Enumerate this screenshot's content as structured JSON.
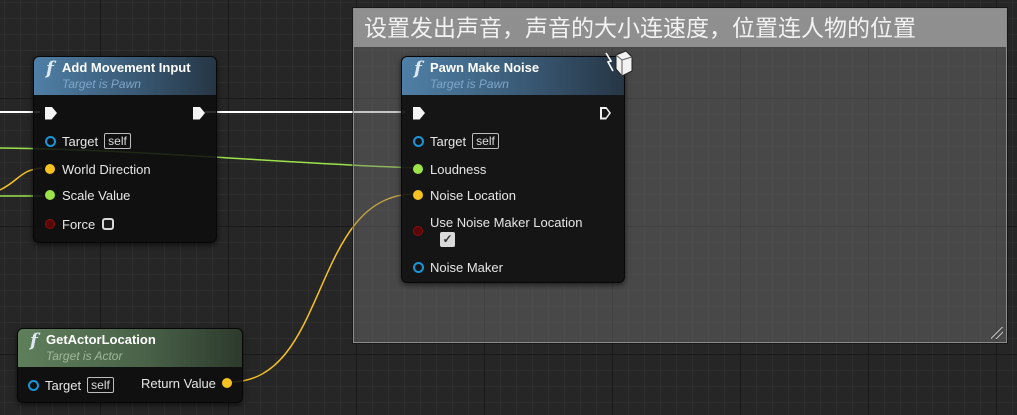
{
  "comment": {
    "title": "设置发出声音，声音的大小连速度，位置连人物的位置"
  },
  "nodes": {
    "add_movement_input": {
      "title": "Add Movement Input",
      "subtitle": "Target is Pawn",
      "pins": {
        "target": "Target",
        "target_default": "self",
        "world_direction": "World Direction",
        "scale_value": "Scale Value",
        "force": "Force"
      }
    },
    "pawn_make_noise": {
      "title": "Pawn Make Noise",
      "subtitle": "Target is Pawn",
      "pins": {
        "target": "Target",
        "target_default": "self",
        "loudness": "Loudness",
        "noise_location": "Noise Location",
        "use_noise_maker_location": "Use Noise Maker Location",
        "noise_maker": "Noise Maker"
      }
    },
    "get_actor_location": {
      "title": "GetActorLocation",
      "subtitle": "Target is Actor",
      "pins": {
        "target": "Target",
        "target_default": "self",
        "return_value": "Return Value"
      }
    }
  },
  "icons": {
    "function": "f",
    "checkmark": "✓"
  },
  "colors": {
    "exec_wire": "#ffffff",
    "float_wire": "#9ce34a",
    "vector_wire": "#f5c222",
    "object_pin": "#1a96d8",
    "bool_pin": "#8a1010"
  }
}
